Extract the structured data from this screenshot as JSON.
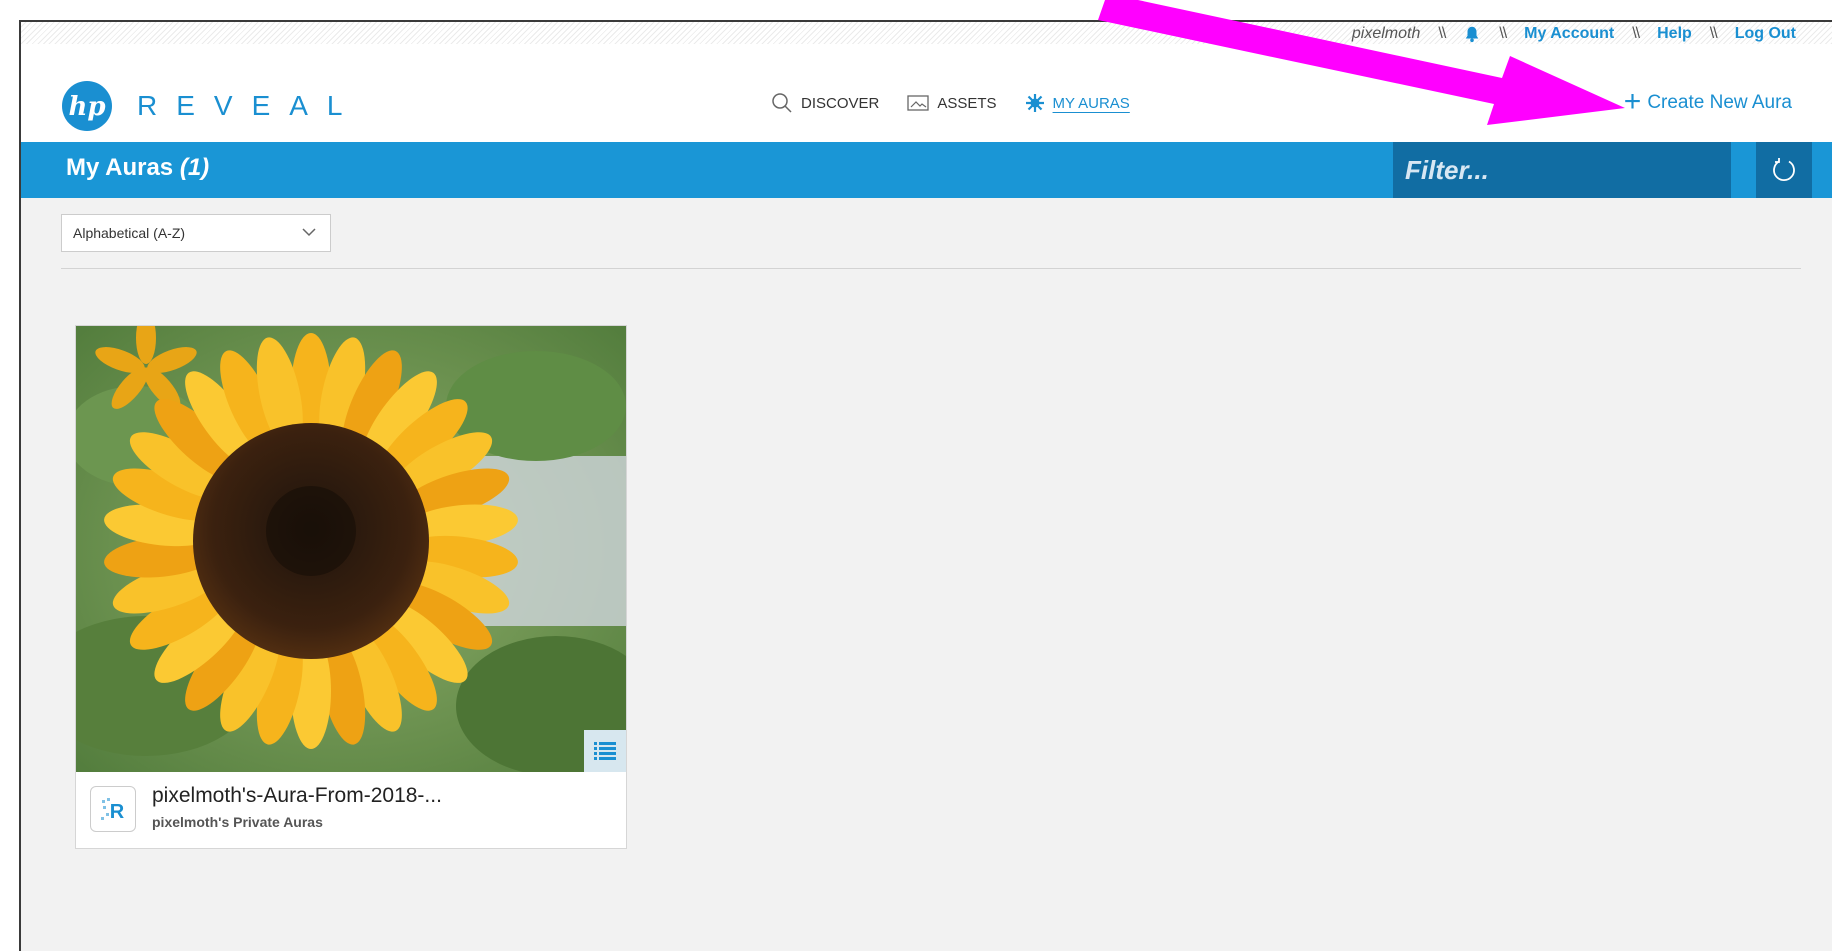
{
  "top_links": {
    "user": "pixelmoth",
    "my_account": "My Account",
    "help": "Help",
    "log_out": "Log Out",
    "separator": "\\\\"
  },
  "brand": {
    "logo_text": "REVEAL",
    "hp_mark": "hp"
  },
  "nav": {
    "discover": "DISCOVER",
    "assets": "ASSETS",
    "my_auras": "MY AURAS"
  },
  "create_new_aura": "Create New Aura",
  "bar": {
    "title": "My Auras",
    "count": "(1)",
    "filter_placeholder": "Filter..."
  },
  "sort": {
    "selected": "Alphabetical (A-Z)"
  },
  "cards": [
    {
      "title": "pixelmoth's-Aura-From-2018-...",
      "subtitle": "pixelmoth's Private Auras",
      "icon_letter": "R"
    }
  ],
  "colors": {
    "accent": "#1a96d6",
    "dark_accent": "#116da3",
    "annotation": "#ff00ff"
  }
}
